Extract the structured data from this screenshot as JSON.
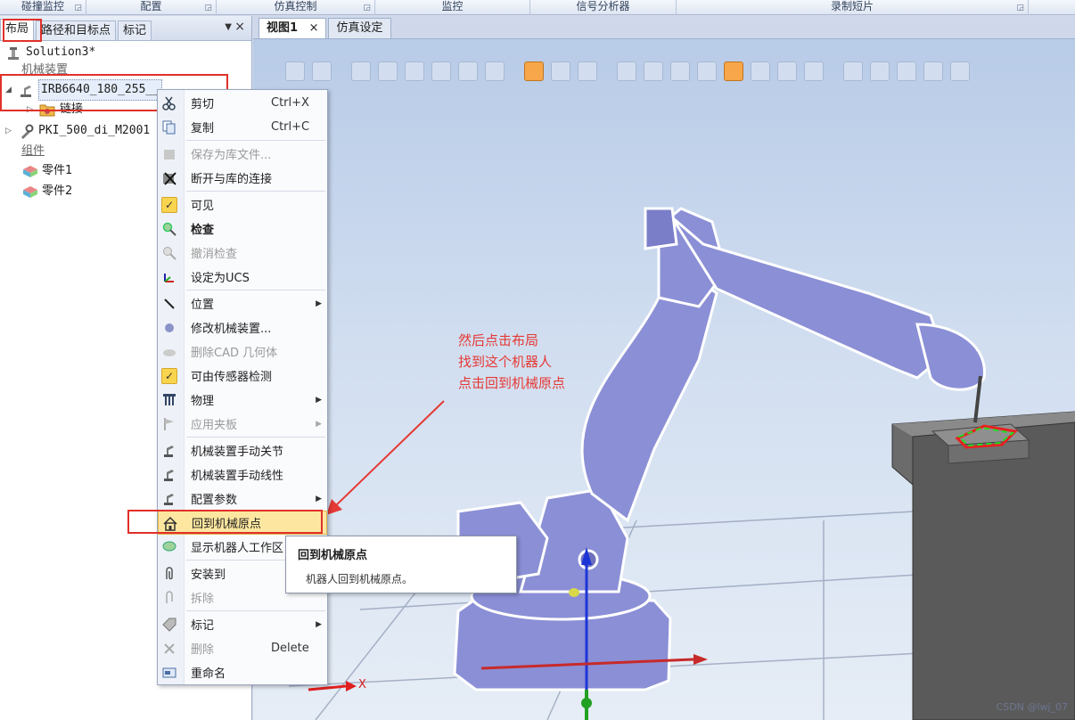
{
  "ribbon": {
    "groups": [
      {
        "label": "碰撞监控",
        "launcher": true
      },
      {
        "label": "配置",
        "launcher": true
      },
      {
        "label": "仿真控制",
        "launcher": true
      },
      {
        "label": "监控",
        "launcher": false
      },
      {
        "label": "信号分析器",
        "launcher": false
      },
      {
        "label": "录制短片",
        "launcher": true
      }
    ]
  },
  "left_panel": {
    "tabs": [
      "布局",
      "路径和目标点",
      "标记"
    ],
    "active_tab": "布局",
    "tree": {
      "solution": "Solution3*",
      "mechanisms_header": "机械装置",
      "robot": "IRB6640_180_255__",
      "links": "链接",
      "tool": "PKI_500_di_M2001",
      "components_header": "组件",
      "part1": "零件1",
      "part2": "零件2"
    }
  },
  "viewport": {
    "tabs": [
      {
        "label": "视图1",
        "close": "×"
      },
      {
        "label": "仿真设定"
      }
    ],
    "axis_label": "X",
    "annotation": [
      "然后点击布局",
      "找到这个机器人",
      "点击回到机械原点"
    ],
    "watermark": "CSDN @lwj_07"
  },
  "context_menu": {
    "items": [
      {
        "label": "剪切",
        "shortcut": "Ctrl+X",
        "icon": "scissors-icon"
      },
      {
        "label": "复制",
        "shortcut": "Ctrl+C",
        "icon": "copy-icon"
      },
      {
        "label": "保存为库文件...",
        "disabled": true,
        "icon": "save-library-icon"
      },
      {
        "label": "断开与库的连接",
        "icon": "disconnect-icon"
      },
      {
        "label": "可见",
        "checked": true,
        "icon": "check-icon"
      },
      {
        "label": "检查",
        "bold": true,
        "icon": "inspect-icon"
      },
      {
        "label": "撤消检查",
        "disabled": true,
        "icon": "undo-inspect-icon"
      },
      {
        "label": "设定为UCS",
        "icon": "ucs-icon"
      },
      {
        "label": "位置",
        "submenu": true,
        "icon": "position-icon"
      },
      {
        "label": "修改机械装置...",
        "icon": "modify-mechanism-icon"
      },
      {
        "label": "删除CAD 几何体",
        "disabled": true,
        "icon": "delete-cad-icon"
      },
      {
        "label": "可由传感器检测",
        "checked": true,
        "icon": "check-icon"
      },
      {
        "label": "物理",
        "submenu": true,
        "icon": "physics-icon"
      },
      {
        "label": "应用夹板",
        "submenu": true,
        "disabled": true,
        "icon": "flag-icon"
      },
      {
        "label": "机械装置手动关节",
        "icon": "jog-joint-icon"
      },
      {
        "label": "机械装置手动线性",
        "icon": "jog-linear-icon"
      },
      {
        "label": "配置参数",
        "submenu": true,
        "icon": "config-icon"
      },
      {
        "label": "回到机械原点",
        "highlighted": true,
        "icon": "home-icon"
      },
      {
        "label": "显示机器人工作区",
        "icon": "workspace-icon"
      },
      {
        "label": "安装到",
        "icon": "attach-icon"
      },
      {
        "label": "拆除",
        "disabled": true,
        "icon": "detach-icon"
      },
      {
        "label": "标记",
        "submenu": true,
        "icon": "tag-icon"
      },
      {
        "label": "删除",
        "shortcut": "Delete",
        "disabled": true,
        "icon": "delete-icon"
      },
      {
        "label": "重命名",
        "icon": "rename-icon"
      }
    ]
  },
  "tooltip": {
    "title": "回到机械原点",
    "description": "机器人回到机械原点。"
  },
  "colors": {
    "annotation_red": "#e53935",
    "robot_body": "#8b8fd6",
    "menu_highlight": "#fde7a0"
  }
}
